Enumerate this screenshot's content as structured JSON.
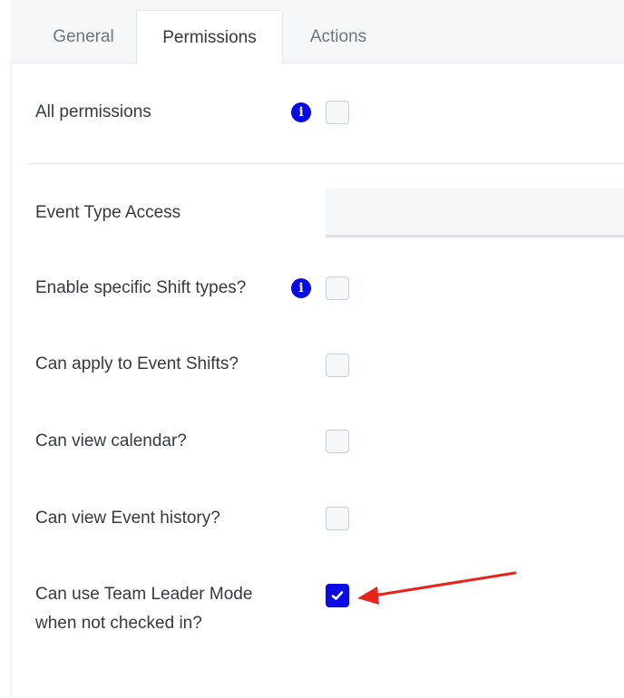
{
  "tabs": [
    {
      "label": "General",
      "active": false
    },
    {
      "label": "Permissions",
      "active": true
    },
    {
      "label": "Actions",
      "active": false
    }
  ],
  "permissions": {
    "all_permissions": {
      "label": "All permissions",
      "has_info": true,
      "checked": false
    },
    "event_type_access": {
      "label": "Event Type Access",
      "value": ""
    },
    "items": [
      {
        "label": "Enable specific Shift types?",
        "has_info": true,
        "checked": false
      },
      {
        "label": "Can apply to Event Shifts?",
        "has_info": false,
        "checked": false
      },
      {
        "label": "Can view calendar?",
        "has_info": false,
        "checked": false
      },
      {
        "label": "Can view Event history?",
        "has_info": false,
        "checked": false
      },
      {
        "label_line1": "Can use Team Leader Mode",
        "label_line2": "when not checked in?",
        "has_info": false,
        "checked": true
      }
    ]
  },
  "icons": {
    "info": "i",
    "check": "✔"
  },
  "colors": {
    "accent": "#0a0ae6",
    "annotation_arrow": "#e8231c",
    "tabbar_bg": "#f6f7f9"
  }
}
